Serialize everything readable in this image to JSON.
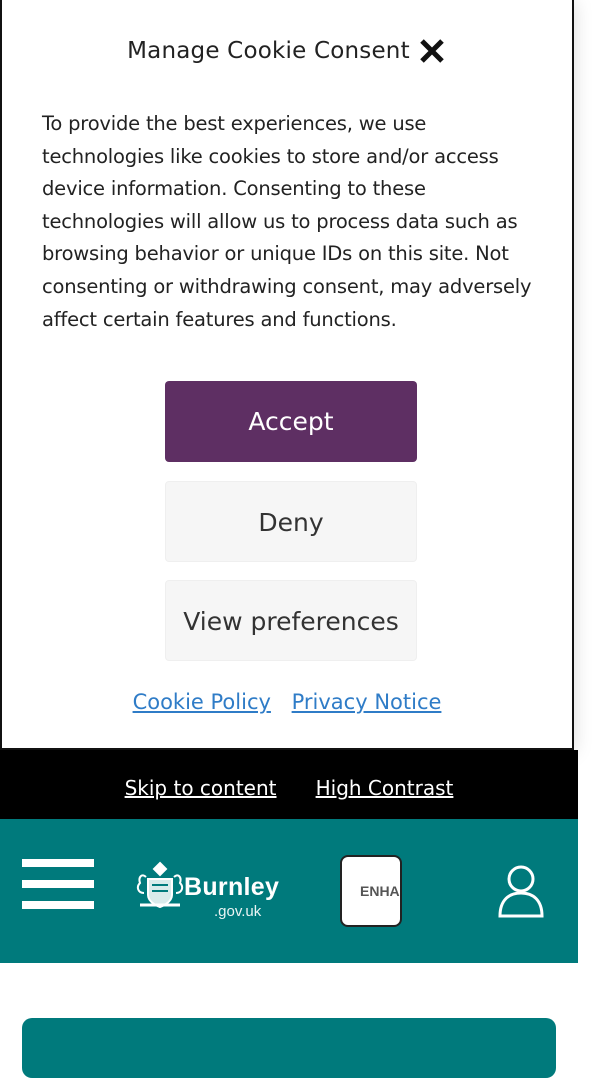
{
  "cookie_modal": {
    "title": "Manage Cookie Consent",
    "close_icon": "close-icon",
    "message": "To provide the best experiences, we use technologies like cookies to store and/or access device information. Consenting to these technologies will allow us to process data such as browsing behavior or unique IDs on this site. Not consenting or withdrawing consent, may adversely affect certain features and functions.",
    "accept_label": "Accept",
    "deny_label": "Deny",
    "preferences_label": "View preferences",
    "links": {
      "cookie_policy": "Cookie Policy",
      "privacy_notice": "Privacy Notice"
    },
    "colors": {
      "accept_bg": "#5e2f63",
      "secondary_bg": "#f6f6f6",
      "link": "#2f7cc7"
    }
  },
  "skip_bar": {
    "skip_to_content": "Skip to content",
    "high_contrast": "High Contrast"
  },
  "header": {
    "menu_icon": "hamburger-menu-icon",
    "logo": {
      "name": "Burnley",
      "domain": ".gov.uk"
    },
    "enhance_button_label": "ENHANCE",
    "user_icon": "user-account-icon",
    "colors": {
      "header_bg": "#007a7c"
    }
  }
}
